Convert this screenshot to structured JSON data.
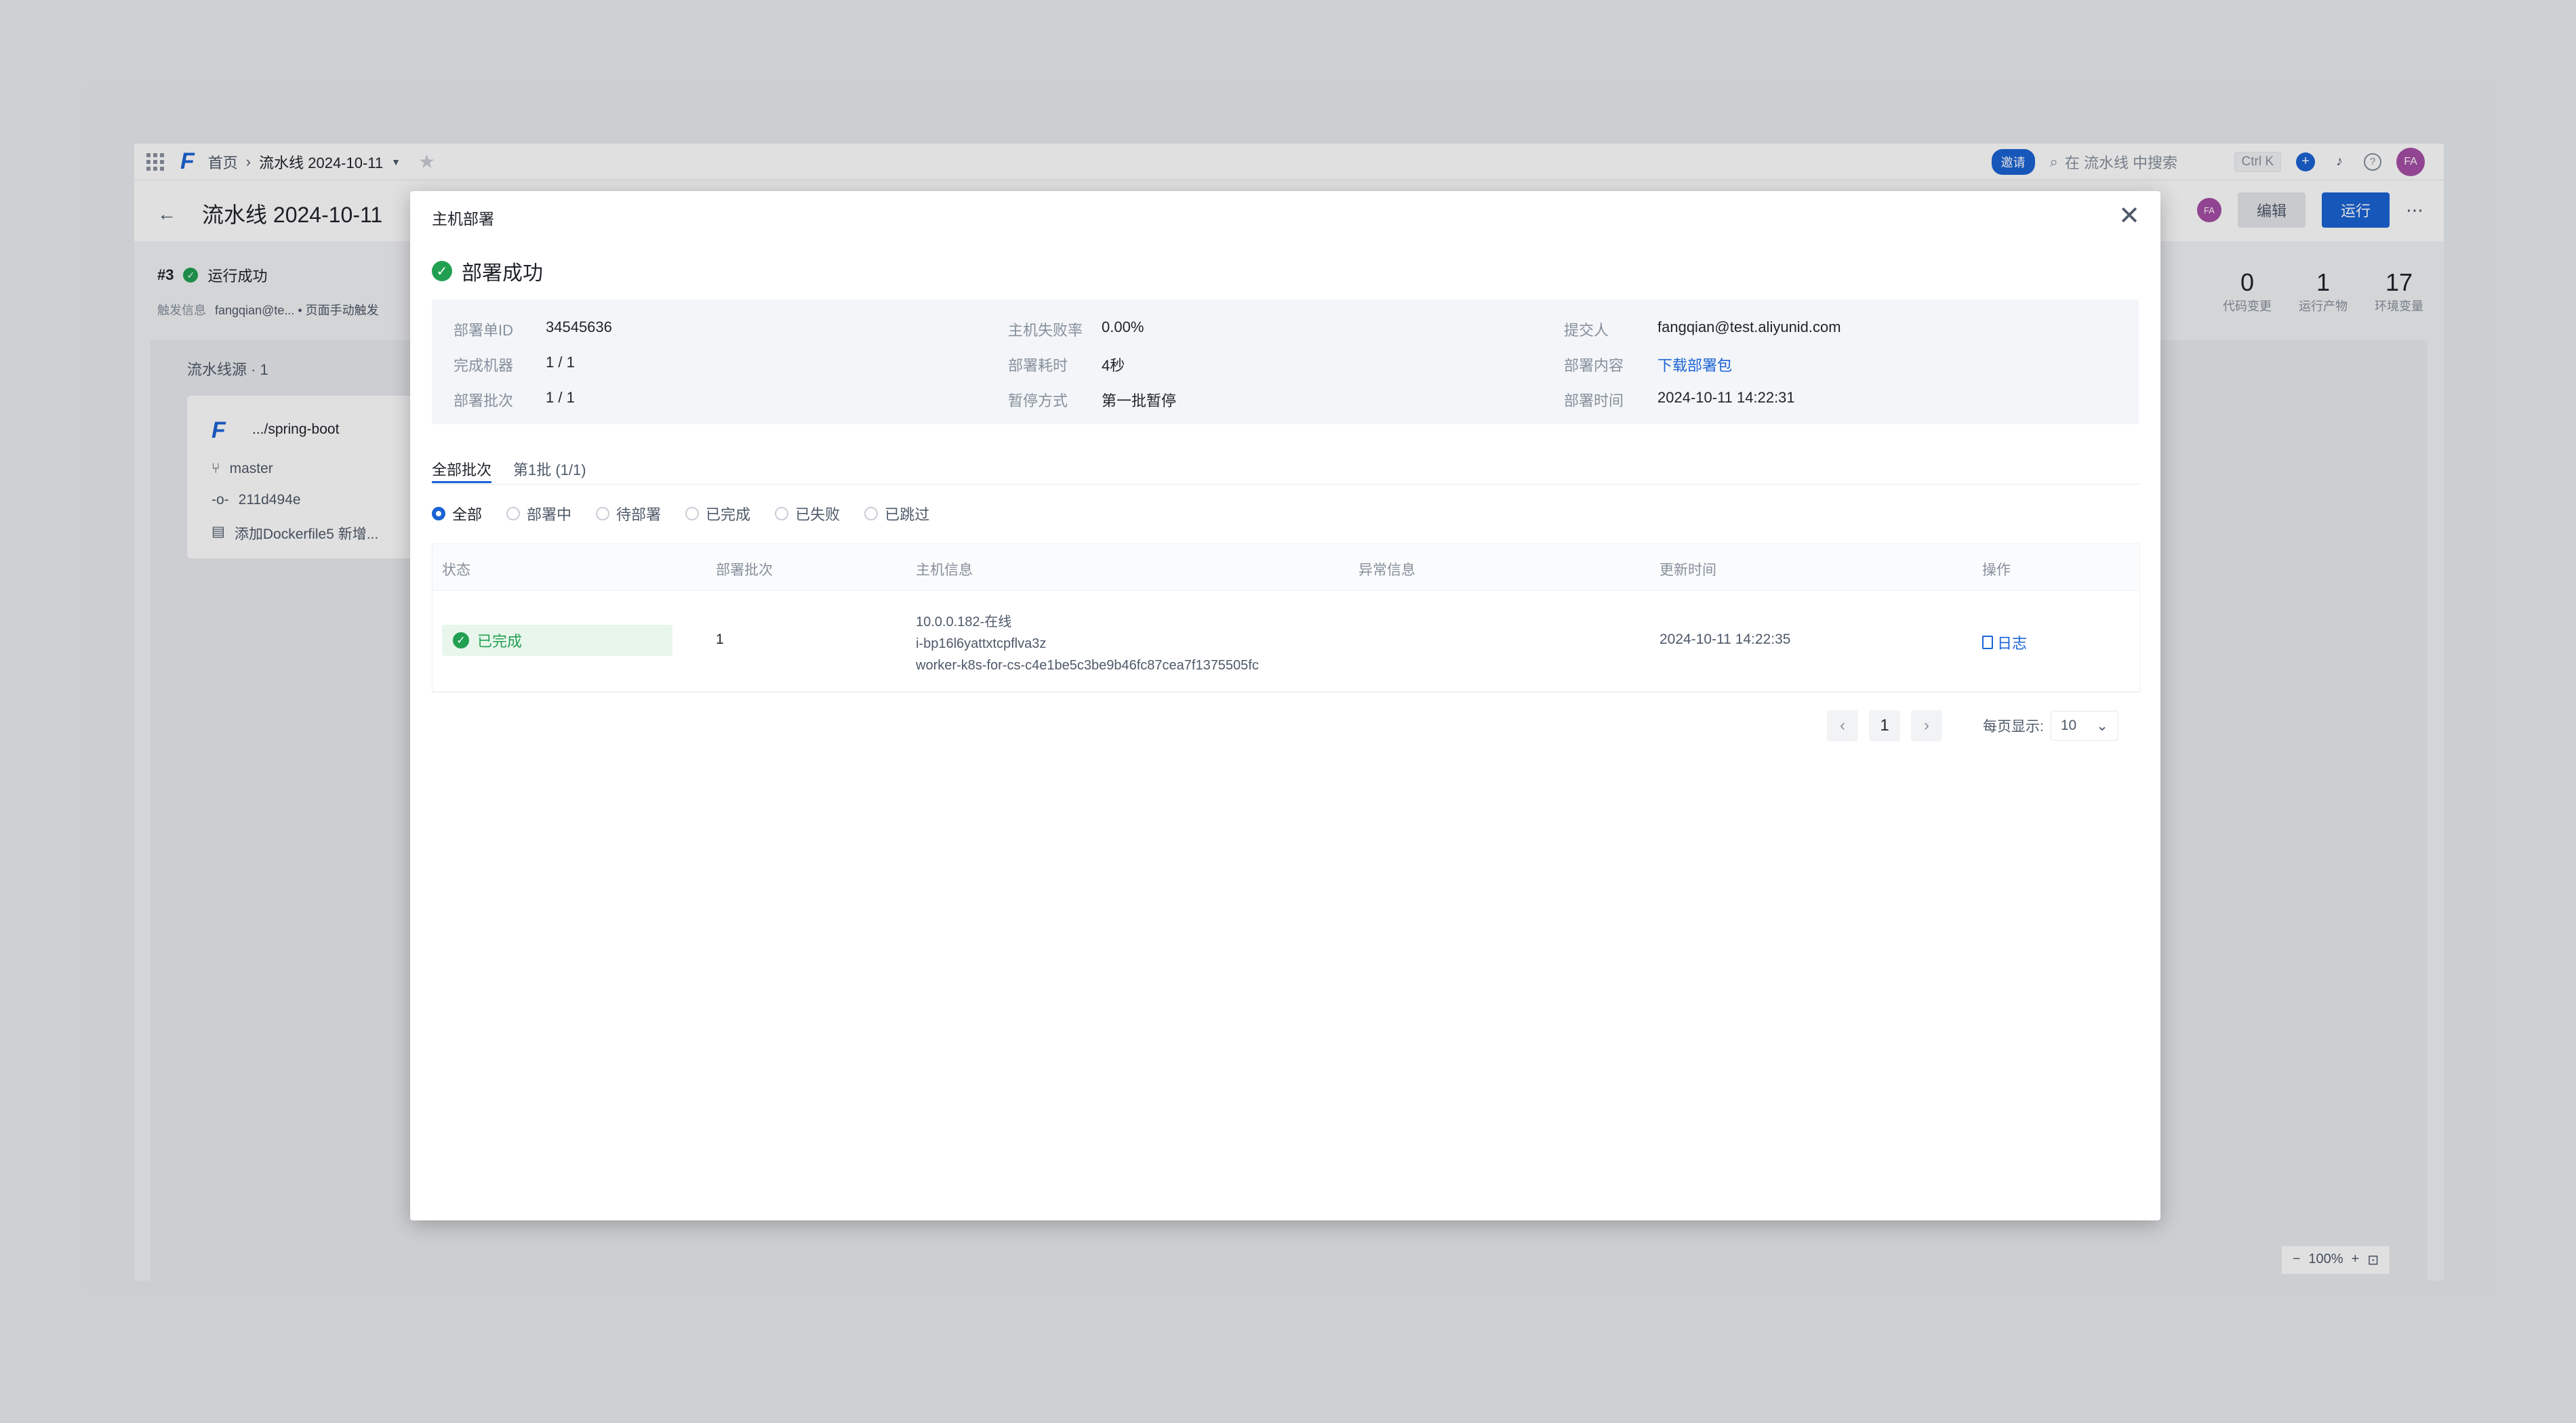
{
  "topbar": {
    "logo": "F",
    "breadcrumb_home": "首页",
    "breadcrumb_pipeline": "流水线 2024-10-11",
    "invite": "邀请",
    "search_placeholder": "在 流水线 中搜索",
    "shortcut": "Ctrl K",
    "avatar": "FA"
  },
  "page": {
    "title": "流水线 2024-10-11",
    "run_no": "#3",
    "run_status": "运行成功",
    "trigger_label": "触发信息",
    "trigger_value": "fangqian@te... • 页面手动触发",
    "edit": "编辑",
    "run": "运行",
    "avatar": "FA",
    "stats": [
      {
        "value": "0",
        "label": "代码变更"
      },
      {
        "value": "1",
        "label": "运行产物"
      },
      {
        "value": "17",
        "label": "环境变量"
      }
    ],
    "source_title": "流水线源 · 1",
    "source": {
      "repo": ".../spring-boot",
      "branch": "master",
      "commit": "211d494e",
      "message": "添加Dockerfile5 新增..."
    },
    "zoom": "100%"
  },
  "modal": {
    "title": "主机部署",
    "status": "部署成功",
    "info": {
      "deploy_id_label": "部署单ID",
      "deploy_id": "34545636",
      "done_machines_label": "完成机器",
      "done_machines": "1 / 1",
      "batches_label": "部署批次",
      "batches": "1 / 1",
      "fail_rate_label": "主机失败率",
      "fail_rate": "0.00%",
      "duration_label": "部署耗时",
      "duration": "4秒",
      "pause_label": "暂停方式",
      "pause": "第一批暂停",
      "submitter_label": "提交人",
      "submitter": "fangqian@test.aliyunid.com",
      "content_label": "部署内容",
      "content": "下载部署包",
      "time_label": "部署时间",
      "time": "2024-10-11 14:22:31"
    },
    "tabs": [
      "全部批次",
      "第1批 (1/1)"
    ],
    "filters": [
      "全部",
      "部署中",
      "待部署",
      "已完成",
      "已失败",
      "已跳过"
    ],
    "table": {
      "headers": [
        "状态",
        "部署批次",
        "主机信息",
        "异常信息",
        "更新时间",
        "操作"
      ],
      "row": {
        "status": "已完成",
        "batch": "1",
        "host_ip": "10.0.0.182-在线",
        "host_id": "i-bp16l6yattxtcpflva3z",
        "host_name": "worker-k8s-for-cs-c4e1be5c3be9b46fc87cea7f1375505fc",
        "error": "",
        "updated": "2024-10-11 14:22:35",
        "action": "日志"
      }
    },
    "pager": {
      "page": "1",
      "size_label": "每页显示:",
      "size": "10"
    }
  }
}
